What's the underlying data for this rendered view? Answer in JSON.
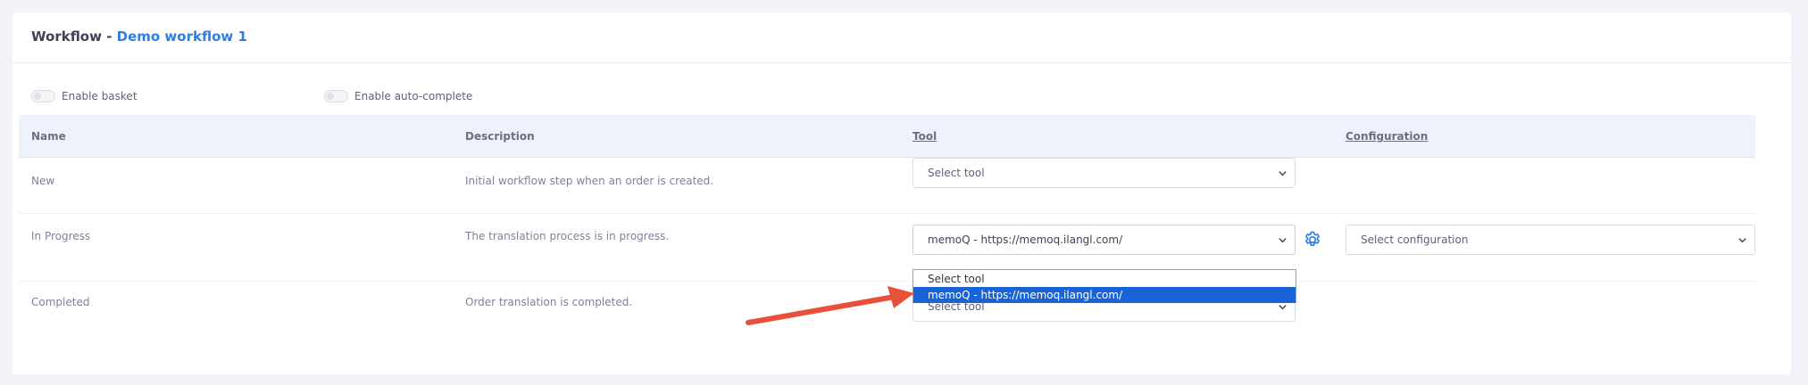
{
  "header": {
    "title_prefix": "Workflow - ",
    "workflow_name": "Demo workflow 1"
  },
  "toggles": {
    "basket": {
      "label": "Enable basket",
      "enabled": false
    },
    "auto_complete": {
      "label": "Enable auto-complete",
      "enabled": false
    }
  },
  "table": {
    "columns": {
      "name": "Name",
      "description": "Description",
      "tool": "Tool",
      "configuration": "Configuration"
    },
    "rows": [
      {
        "name": "New",
        "description": "Initial workflow step when an order is created.",
        "tool_value": "Select tool"
      },
      {
        "name": "In Progress",
        "description": "The translation process is in progress.",
        "tool_value": "memoQ - https://memoq.ilangl.com/",
        "configuration_value": "Select configuration"
      },
      {
        "name": "Completed",
        "description": "Order translation is completed.",
        "tool_value": "Select tool"
      }
    ]
  },
  "dropdown": {
    "options": [
      "Select tool",
      "memoQ - https://memoq.ilangl.com/"
    ],
    "selected_index": 1
  },
  "colors": {
    "accent": "#2e7ee6",
    "selected_option_bg": "#1a63d6",
    "annotation_arrow": "#e8503a"
  },
  "icons": {
    "settings": "gear-icon",
    "select_caret": "chevron-down-icon"
  }
}
